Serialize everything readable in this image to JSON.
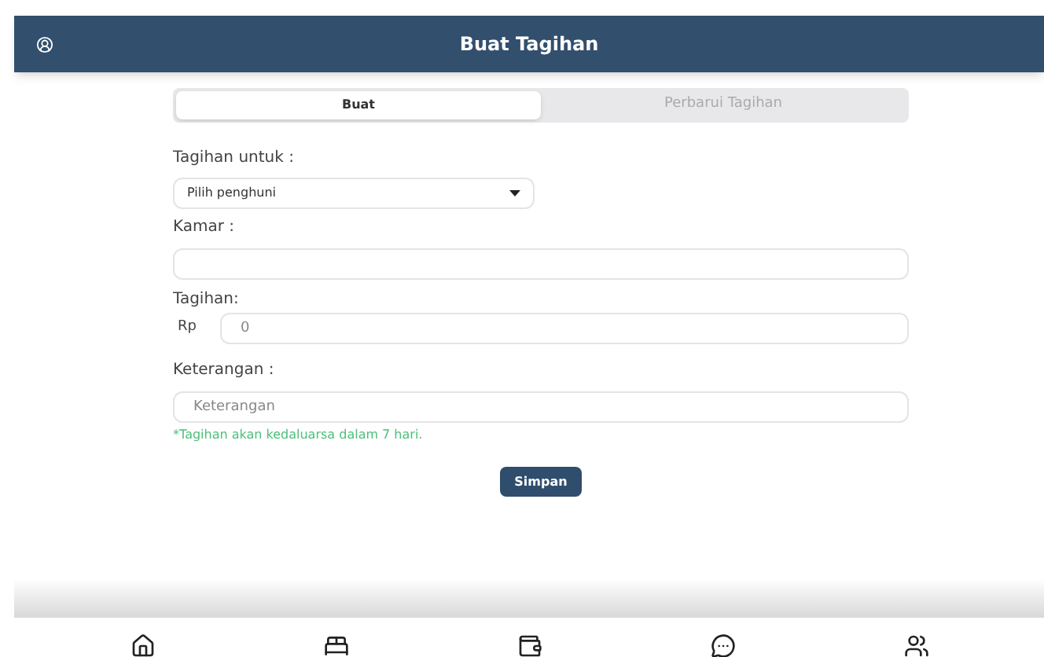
{
  "header": {
    "title": "Buat Tagihan"
  },
  "tabs": [
    {
      "label": "Buat",
      "selected": true
    },
    {
      "label": "Perbarui Tagihan",
      "selected": false
    }
  ],
  "form": {
    "recipient": {
      "label": "Tagihan untuk :",
      "value": "Pilih penghuni"
    },
    "room": {
      "label": "Kamar :"
    },
    "amount": {
      "label": "Tagihan:",
      "prefix": "Rp",
      "placeholder": "0"
    },
    "note": {
      "label": "Keterangan :",
      "placeholder": "Keterangan"
    },
    "hint": "*Tagihan akan kedaluarsa dalam 7 hari.",
    "submit": "Simpan"
  },
  "nav": [
    {
      "kind": "home"
    },
    {
      "kind": "bed"
    },
    {
      "kind": "wallet"
    },
    {
      "kind": "chat"
    },
    {
      "kind": "users"
    }
  ]
}
